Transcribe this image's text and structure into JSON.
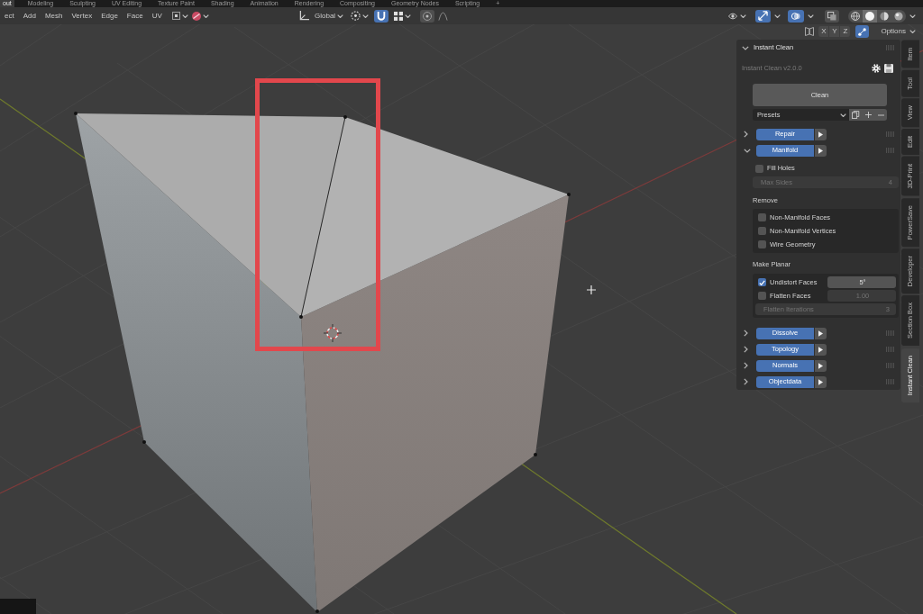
{
  "workspace_tabs": [
    {
      "label": "out",
      "selected": true
    },
    {
      "label": "Modeling",
      "selected": false
    },
    {
      "label": "Sculpting",
      "selected": false
    },
    {
      "label": "UV Editing",
      "selected": false
    },
    {
      "label": "Texture Paint",
      "selected": false
    },
    {
      "label": "Shading",
      "selected": false
    },
    {
      "label": "Animation",
      "selected": false
    },
    {
      "label": "Rendering",
      "selected": false
    },
    {
      "label": "Compositing",
      "selected": false
    },
    {
      "label": "Geometry Nodes",
      "selected": false
    },
    {
      "label": "Scripting",
      "selected": false
    }
  ],
  "add_workspace": "+",
  "header": {
    "menus": [
      "ect",
      "Add",
      "Mesh",
      "Vertex",
      "Edge",
      "Face",
      "UV"
    ],
    "orientation": "Global",
    "snapping": true,
    "proportional_editing": false,
    "gizmos": true,
    "overlays": true,
    "xray": false,
    "shading_modes": [
      {
        "kind": "wireframe",
        "selected": false
      },
      {
        "kind": "solid",
        "selected": true
      },
      {
        "kind": "material",
        "selected": false
      },
      {
        "kind": "rendered",
        "selected": false
      }
    ]
  },
  "mirror": {
    "axes": [
      {
        "label": "X",
        "on": false
      },
      {
        "label": "Y",
        "on": false
      },
      {
        "label": "Z",
        "on": false
      }
    ],
    "toggle": true,
    "options": "Options"
  },
  "sidebar": {
    "title": "Instant Clean",
    "version": "Instant Clean v2.0.0",
    "clean_button": "Clean",
    "presets": "Presets",
    "sections": [
      {
        "label": "Repair",
        "expanded": false
      },
      {
        "label": "Manifold",
        "expanded": true,
        "fill_holes": {
          "label": "Fill Holes",
          "checked": false
        },
        "max_sides": {
          "label": "Max Sides",
          "value": "4",
          "disabled": true
        },
        "remove": {
          "title": "Remove",
          "options": [
            {
              "label": "Non-Manifold Faces",
              "checked": false
            },
            {
              "label": "Non-Manifold Vertices",
              "checked": false
            },
            {
              "label": "Wire Geometry",
              "checked": false
            }
          ]
        },
        "make_planar": {
          "title": "Make Planar",
          "rows": [
            {
              "kind": "check",
              "label": "Undistort Faces",
              "checked": true,
              "value": "5°",
              "disabled": false
            },
            {
              "kind": "check",
              "label": "Flatten Faces",
              "checked": false,
              "value": "1.00",
              "disabled": true
            },
            {
              "kind": "field",
              "label": "Flatten Iterations",
              "value": "3",
              "disabled": true
            }
          ]
        }
      },
      {
        "label": "Dissolve",
        "expanded": false
      },
      {
        "label": "Topology",
        "expanded": false
      },
      {
        "label": "Normals",
        "expanded": false
      },
      {
        "label": "Objectdata",
        "expanded": false
      }
    ]
  },
  "sidebar_tabs": [
    {
      "label": "Item",
      "selected": false
    },
    {
      "label": "Tool",
      "selected": false
    },
    {
      "label": "View",
      "selected": false
    },
    {
      "label": "Edit",
      "selected": false
    },
    {
      "label": "3D-Print",
      "selected": false
    },
    {
      "label": "PowerSave",
      "selected": false
    },
    {
      "label": "Developer",
      "selected": false
    },
    {
      "label": "Section Box",
      "selected": false
    },
    {
      "label": "Instant Clean",
      "selected": true
    }
  ]
}
